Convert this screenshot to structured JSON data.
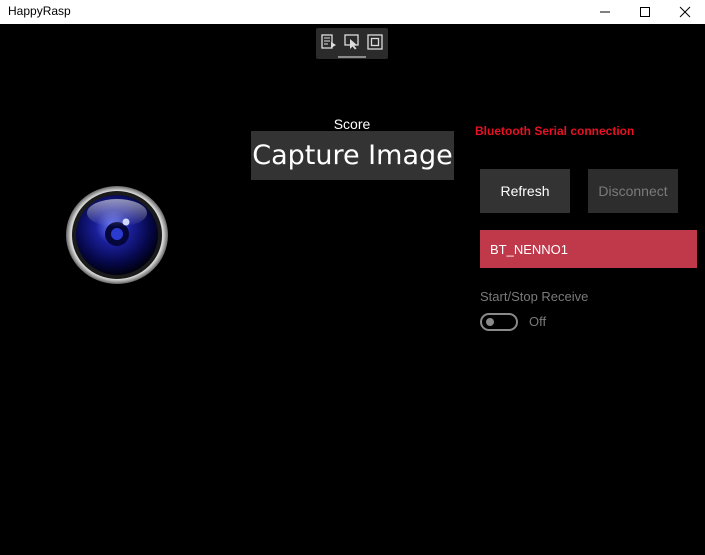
{
  "window": {
    "title": "HappyRasp"
  },
  "debug_toolbar": {
    "icons": [
      "live-visual-tree-icon",
      "select-element-icon",
      "display-layout-adorners-icon"
    ]
  },
  "main": {
    "score_label": "Score",
    "capture_button": "Capture Image",
    "camera_icon": "camera-lens-icon"
  },
  "bluetooth": {
    "title": "Bluetooth Serial connection",
    "title_color": "#e81123",
    "refresh_label": "Refresh",
    "disconnect_label": "Disconnect",
    "devices": [
      "BT_NENNO1"
    ],
    "selected_color": "#c0394b",
    "toggle_label": "Start/Stop Receive",
    "toggle_state": "Off"
  }
}
